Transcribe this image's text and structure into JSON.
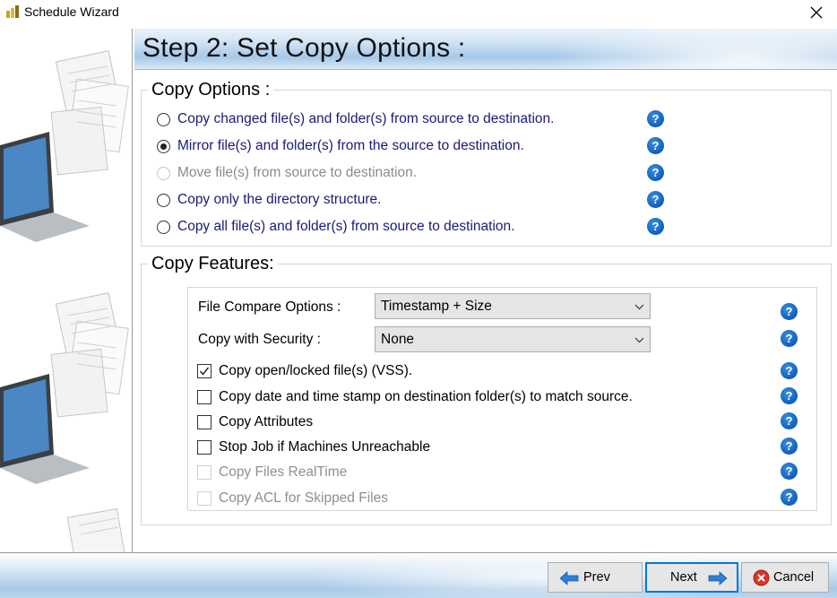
{
  "window": {
    "title": "Schedule Wizard",
    "app_icon": "wizard-wand-icon",
    "close_icon": "close-icon"
  },
  "header": {
    "title": "Step 2: Set Copy Options :"
  },
  "copy_options": {
    "legend": "Copy Options :",
    "options": [
      {
        "label": "Copy changed file(s) and folder(s) from source to destination.",
        "selected": false,
        "disabled": false
      },
      {
        "label": "Mirror file(s) and folder(s) from the source to destination.",
        "selected": true,
        "disabled": false
      },
      {
        "label": "Move file(s) from source to destination.",
        "selected": false,
        "disabled": true
      },
      {
        "label": "Copy only the directory structure.",
        "selected": false,
        "disabled": false
      },
      {
        "label": "Copy all file(s) and folder(s) from source to destination.",
        "selected": false,
        "disabled": false
      }
    ]
  },
  "copy_features": {
    "legend": "Copy Features:",
    "file_compare": {
      "label": "File Compare Options :",
      "value": "Timestamp + Size"
    },
    "security": {
      "label": "Copy with Security :",
      "value": "None"
    },
    "checks": [
      {
        "label": "Copy open/locked file(s) (VSS).",
        "checked": true,
        "disabled": false
      },
      {
        "label": "Copy date and time stamp on destination folder(s) to match source.",
        "checked": false,
        "disabled": false
      },
      {
        "label": "Copy Attributes",
        "checked": false,
        "disabled": false
      },
      {
        "label": "Stop Job if Machines Unreachable",
        "checked": false,
        "disabled": false
      },
      {
        "label": "Copy Files RealTime",
        "checked": false,
        "disabled": true
      },
      {
        "label": "Copy ACL for Skipped Files",
        "checked": false,
        "disabled": true
      }
    ]
  },
  "help": {
    "glyph": "?",
    "icon": "help-icon"
  },
  "footer": {
    "prev_label": "Prev",
    "next_label": "Next",
    "cancel_label": "Cancel"
  },
  "colors": {
    "option_text": "#1a1a7a",
    "help_blue": "#1565c0",
    "header_blue": "#a6c8e8",
    "default_button_border": "#0078d7"
  }
}
